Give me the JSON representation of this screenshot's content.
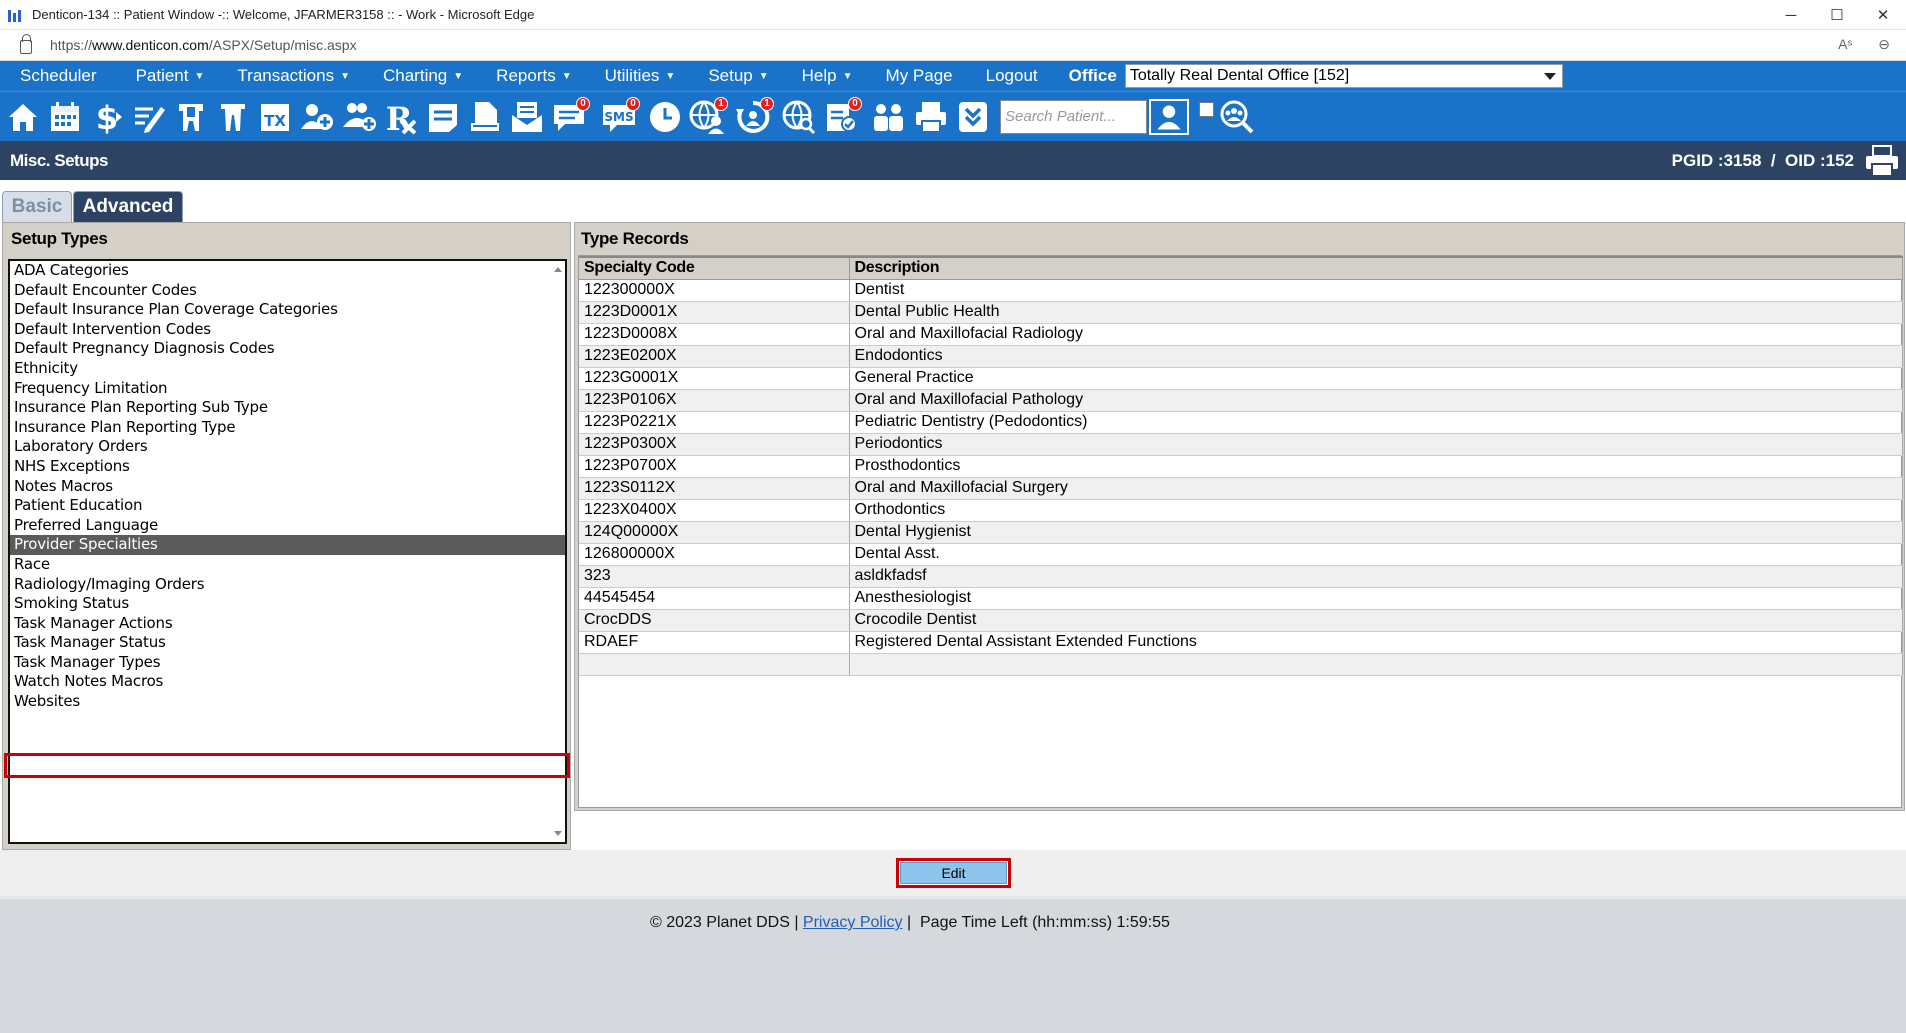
{
  "window": {
    "title": "Denticon-134 :: Patient Window -:: Welcome, JFARMER3158 :: - Work - Microsoft Edge",
    "url_prefix": "https://",
    "url_host": "www.denticon.com",
    "url_path": "/ASPX/Setup/misc.aspx",
    "minimize": "─",
    "maximize": "☐",
    "close": "✕"
  },
  "menu": {
    "items": [
      {
        "label": "Scheduler",
        "caret": ""
      },
      {
        "label": "Patient",
        "caret": "▼"
      },
      {
        "label": "Transactions",
        "caret": "▼"
      },
      {
        "label": "Charting",
        "caret": "▼"
      },
      {
        "label": "Reports",
        "caret": "▼"
      },
      {
        "label": "Utilities",
        "caret": "▼"
      },
      {
        "label": "Setup",
        "caret": "▼"
      },
      {
        "label": "Help",
        "caret": "▼"
      },
      {
        "label": "My Page",
        "caret": ""
      },
      {
        "label": "Logout",
        "caret": ""
      }
    ],
    "office_label": "Office",
    "office_value": "Totally Real Dental Office [152]"
  },
  "toolbar": {
    "badges": {
      "messages": "0",
      "sms": "0",
      "global": "1",
      "cycle": "1",
      "clipboard": "0"
    },
    "sms_text": "SMS",
    "tx_text": "TX",
    "search_placeholder": "Search Patient..."
  },
  "page": {
    "title": "Misc. Setups",
    "pgid": "PGID :3158  /  OID :152"
  },
  "tabs": {
    "basic": "Basic",
    "advanced": "Advanced"
  },
  "setup_types": {
    "header": "Setup Types",
    "items": [
      "ADA Categories",
      "Default Encounter Codes",
      "Default Insurance Plan Coverage Categories",
      "Default Intervention Codes",
      "Default Pregnancy Diagnosis Codes",
      "Ethnicity",
      "Frequency Limitation",
      "Insurance Plan Reporting Sub Type",
      "Insurance Plan Reporting Type",
      "Laboratory Orders",
      "NHS Exceptions",
      "Notes Macros",
      "Patient Education",
      "Preferred Language",
      "Provider Specialties",
      "Race",
      "Radiology/Imaging Orders",
      "Smoking Status",
      "Task Manager Actions",
      "Task Manager Status",
      "Task Manager Types",
      "Watch Notes Macros",
      "Websites"
    ],
    "selected": "Provider Specialties"
  },
  "type_records": {
    "header": "Type Records",
    "columns": [
      "Specialty Code",
      "Description"
    ],
    "rows": [
      [
        "122300000X",
        "Dentist"
      ],
      [
        "1223D0001X",
        "Dental Public Health"
      ],
      [
        "1223D0008X",
        "Oral and Maxillofacial Radiology"
      ],
      [
        "1223E0200X",
        "Endodontics"
      ],
      [
        "1223G0001X",
        "General Practice"
      ],
      [
        "1223P0106X",
        "Oral and Maxillofacial Pathology"
      ],
      [
        "1223P0221X",
        "Pediatric Dentistry (Pedodontics)"
      ],
      [
        "1223P0300X",
        "Periodontics"
      ],
      [
        "1223P0700X",
        "Prosthodontics"
      ],
      [
        "1223S0112X",
        "Oral and Maxillofacial Surgery"
      ],
      [
        "1223X0400X",
        "Orthodontics"
      ],
      [
        "124Q00000X",
        "Dental Hygienist"
      ],
      [
        "126800000X",
        "Dental Asst."
      ],
      [
        "323",
        "asldkfadsf"
      ],
      [
        "44545454",
        "Anesthesiologist"
      ],
      [
        "CrocDDS",
        "Crocodile Dentist"
      ],
      [
        "RDAEF",
        "Registered Dental Assistant Extended Functions"
      ],
      [
        "",
        ""
      ]
    ]
  },
  "actions": {
    "edit": "Edit"
  },
  "footer": {
    "copyright": "© 2023 Planet DDS | ",
    "privacy": "Privacy Policy",
    "separator": " |  ",
    "time_left": "Page Time Left (hh:mm:ss) 1:59:55"
  },
  "colors": {
    "menu_bg": "#1a73c9",
    "header_bg": "#2d4363",
    "highlight_outline": "#cc0000",
    "edit_button": "#8ec4ec"
  }
}
